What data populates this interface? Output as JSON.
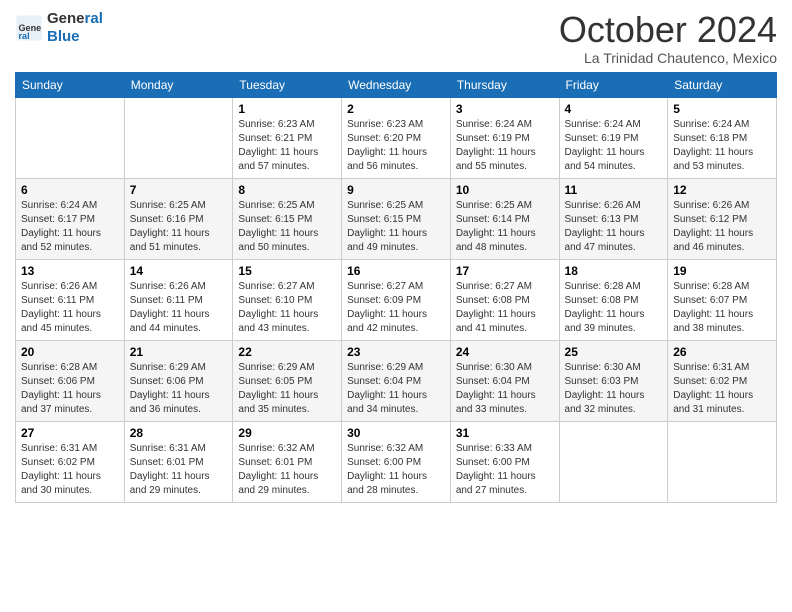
{
  "app": {
    "name": "General",
    "name2": "Blue"
  },
  "header": {
    "title": "October 2024",
    "location": "La Trinidad Chautenco, Mexico"
  },
  "weekdays": [
    "Sunday",
    "Monday",
    "Tuesday",
    "Wednesday",
    "Thursday",
    "Friday",
    "Saturday"
  ],
  "weeks": [
    [
      {
        "day": "",
        "sunrise": "",
        "sunset": "",
        "daylight": ""
      },
      {
        "day": "",
        "sunrise": "",
        "sunset": "",
        "daylight": ""
      },
      {
        "day": "1",
        "sunrise": "Sunrise: 6:23 AM",
        "sunset": "Sunset: 6:21 PM",
        "daylight": "Daylight: 11 hours and 57 minutes."
      },
      {
        "day": "2",
        "sunrise": "Sunrise: 6:23 AM",
        "sunset": "Sunset: 6:20 PM",
        "daylight": "Daylight: 11 hours and 56 minutes."
      },
      {
        "day": "3",
        "sunrise": "Sunrise: 6:24 AM",
        "sunset": "Sunset: 6:19 PM",
        "daylight": "Daylight: 11 hours and 55 minutes."
      },
      {
        "day": "4",
        "sunrise": "Sunrise: 6:24 AM",
        "sunset": "Sunset: 6:19 PM",
        "daylight": "Daylight: 11 hours and 54 minutes."
      },
      {
        "day": "5",
        "sunrise": "Sunrise: 6:24 AM",
        "sunset": "Sunset: 6:18 PM",
        "daylight": "Daylight: 11 hours and 53 minutes."
      }
    ],
    [
      {
        "day": "6",
        "sunrise": "Sunrise: 6:24 AM",
        "sunset": "Sunset: 6:17 PM",
        "daylight": "Daylight: 11 hours and 52 minutes."
      },
      {
        "day": "7",
        "sunrise": "Sunrise: 6:25 AM",
        "sunset": "Sunset: 6:16 PM",
        "daylight": "Daylight: 11 hours and 51 minutes."
      },
      {
        "day": "8",
        "sunrise": "Sunrise: 6:25 AM",
        "sunset": "Sunset: 6:15 PM",
        "daylight": "Daylight: 11 hours and 50 minutes."
      },
      {
        "day": "9",
        "sunrise": "Sunrise: 6:25 AM",
        "sunset": "Sunset: 6:15 PM",
        "daylight": "Daylight: 11 hours and 49 minutes."
      },
      {
        "day": "10",
        "sunrise": "Sunrise: 6:25 AM",
        "sunset": "Sunset: 6:14 PM",
        "daylight": "Daylight: 11 hours and 48 minutes."
      },
      {
        "day": "11",
        "sunrise": "Sunrise: 6:26 AM",
        "sunset": "Sunset: 6:13 PM",
        "daylight": "Daylight: 11 hours and 47 minutes."
      },
      {
        "day": "12",
        "sunrise": "Sunrise: 6:26 AM",
        "sunset": "Sunset: 6:12 PM",
        "daylight": "Daylight: 11 hours and 46 minutes."
      }
    ],
    [
      {
        "day": "13",
        "sunrise": "Sunrise: 6:26 AM",
        "sunset": "Sunset: 6:11 PM",
        "daylight": "Daylight: 11 hours and 45 minutes."
      },
      {
        "day": "14",
        "sunrise": "Sunrise: 6:26 AM",
        "sunset": "Sunset: 6:11 PM",
        "daylight": "Daylight: 11 hours and 44 minutes."
      },
      {
        "day": "15",
        "sunrise": "Sunrise: 6:27 AM",
        "sunset": "Sunset: 6:10 PM",
        "daylight": "Daylight: 11 hours and 43 minutes."
      },
      {
        "day": "16",
        "sunrise": "Sunrise: 6:27 AM",
        "sunset": "Sunset: 6:09 PM",
        "daylight": "Daylight: 11 hours and 42 minutes."
      },
      {
        "day": "17",
        "sunrise": "Sunrise: 6:27 AM",
        "sunset": "Sunset: 6:08 PM",
        "daylight": "Daylight: 11 hours and 41 minutes."
      },
      {
        "day": "18",
        "sunrise": "Sunrise: 6:28 AM",
        "sunset": "Sunset: 6:08 PM",
        "daylight": "Daylight: 11 hours and 39 minutes."
      },
      {
        "day": "19",
        "sunrise": "Sunrise: 6:28 AM",
        "sunset": "Sunset: 6:07 PM",
        "daylight": "Daylight: 11 hours and 38 minutes."
      }
    ],
    [
      {
        "day": "20",
        "sunrise": "Sunrise: 6:28 AM",
        "sunset": "Sunset: 6:06 PM",
        "daylight": "Daylight: 11 hours and 37 minutes."
      },
      {
        "day": "21",
        "sunrise": "Sunrise: 6:29 AM",
        "sunset": "Sunset: 6:06 PM",
        "daylight": "Daylight: 11 hours and 36 minutes."
      },
      {
        "day": "22",
        "sunrise": "Sunrise: 6:29 AM",
        "sunset": "Sunset: 6:05 PM",
        "daylight": "Daylight: 11 hours and 35 minutes."
      },
      {
        "day": "23",
        "sunrise": "Sunrise: 6:29 AM",
        "sunset": "Sunset: 6:04 PM",
        "daylight": "Daylight: 11 hours and 34 minutes."
      },
      {
        "day": "24",
        "sunrise": "Sunrise: 6:30 AM",
        "sunset": "Sunset: 6:04 PM",
        "daylight": "Daylight: 11 hours and 33 minutes."
      },
      {
        "day": "25",
        "sunrise": "Sunrise: 6:30 AM",
        "sunset": "Sunset: 6:03 PM",
        "daylight": "Daylight: 11 hours and 32 minutes."
      },
      {
        "day": "26",
        "sunrise": "Sunrise: 6:31 AM",
        "sunset": "Sunset: 6:02 PM",
        "daylight": "Daylight: 11 hours and 31 minutes."
      }
    ],
    [
      {
        "day": "27",
        "sunrise": "Sunrise: 6:31 AM",
        "sunset": "Sunset: 6:02 PM",
        "daylight": "Daylight: 11 hours and 30 minutes."
      },
      {
        "day": "28",
        "sunrise": "Sunrise: 6:31 AM",
        "sunset": "Sunset: 6:01 PM",
        "daylight": "Daylight: 11 hours and 29 minutes."
      },
      {
        "day": "29",
        "sunrise": "Sunrise: 6:32 AM",
        "sunset": "Sunset: 6:01 PM",
        "daylight": "Daylight: 11 hours and 29 minutes."
      },
      {
        "day": "30",
        "sunrise": "Sunrise: 6:32 AM",
        "sunset": "Sunset: 6:00 PM",
        "daylight": "Daylight: 11 hours and 28 minutes."
      },
      {
        "day": "31",
        "sunrise": "Sunrise: 6:33 AM",
        "sunset": "Sunset: 6:00 PM",
        "daylight": "Daylight: 11 hours and 27 minutes."
      },
      {
        "day": "",
        "sunrise": "",
        "sunset": "",
        "daylight": ""
      },
      {
        "day": "",
        "sunrise": "",
        "sunset": "",
        "daylight": ""
      }
    ]
  ]
}
